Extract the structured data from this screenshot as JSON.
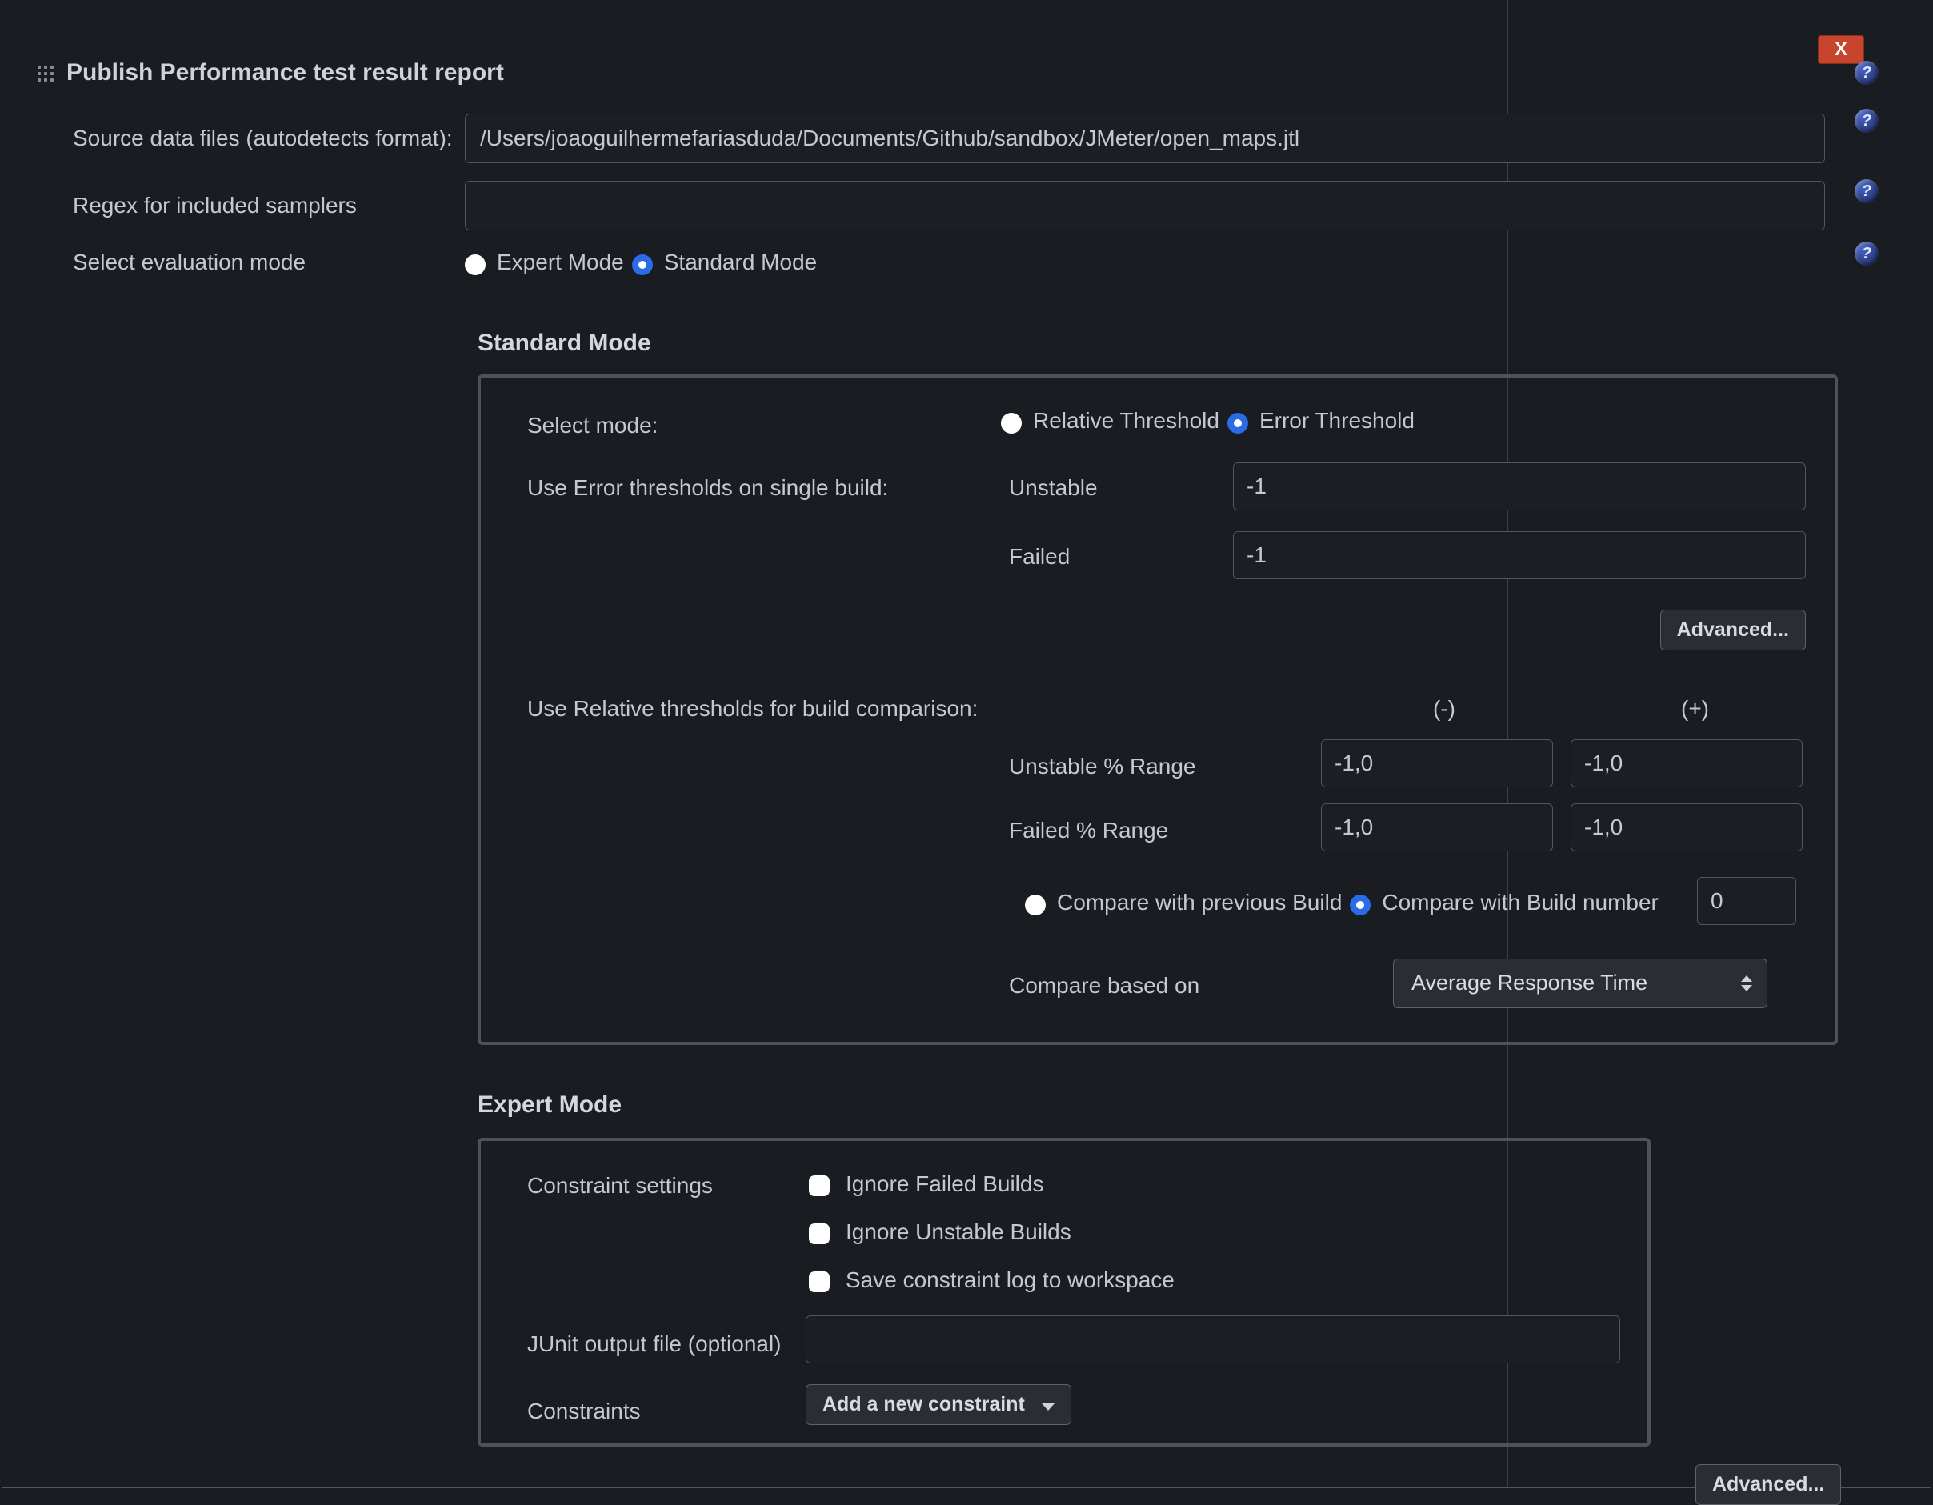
{
  "header": {
    "title": "Publish Performance test result report",
    "close_label": "X"
  },
  "form": {
    "source_label": "Source data files (autodetects format):",
    "source_value": "/Users/joaoguilhermefariasduda/Documents/Github/sandbox/JMeter/open_maps.jtl",
    "regex_label": "Regex for included samplers",
    "regex_value": "",
    "eval_label": "Select evaluation mode",
    "eval_expert": "Expert Mode",
    "eval_standard": "Standard Mode"
  },
  "standard": {
    "heading": "Standard Mode",
    "select_mode_label": "Select mode:",
    "relative_threshold": "Relative Threshold",
    "error_threshold": "Error Threshold",
    "err_thresh_label": "Use Error thresholds on single build:",
    "unstable_label": "Unstable",
    "unstable_value": "-1",
    "failed_label": "Failed",
    "failed_value": "-1",
    "advanced_btn": "Advanced...",
    "rel_thresh_label": "Use Relative thresholds for build comparison:",
    "minus_header": "(-)",
    "plus_header": "(+)",
    "unstable_pct_label": "Unstable % Range",
    "unstable_minus": "-1,0",
    "unstable_plus": "-1,0",
    "failed_pct_label": "Failed % Range",
    "failed_minus": "-1,0",
    "failed_plus": "-1,0",
    "compare_prev": "Compare with previous Build",
    "compare_num": "Compare with Build number",
    "compare_num_value": "0",
    "compare_based_label": "Compare based on",
    "compare_based_value": "Average Response Time"
  },
  "expert": {
    "heading": "Expert Mode",
    "constraint_settings_label": "Constraint settings",
    "ignore_failed": "Ignore Failed Builds",
    "ignore_unstable": "Ignore Unstable Builds",
    "save_log": "Save constraint log to workspace",
    "junit_label": "JUnit output file (optional)",
    "junit_value": "",
    "constraints_label": "Constraints",
    "add_constraint_btn": "Add a new constraint"
  },
  "footer": {
    "advanced_btn": "Advanced..."
  }
}
